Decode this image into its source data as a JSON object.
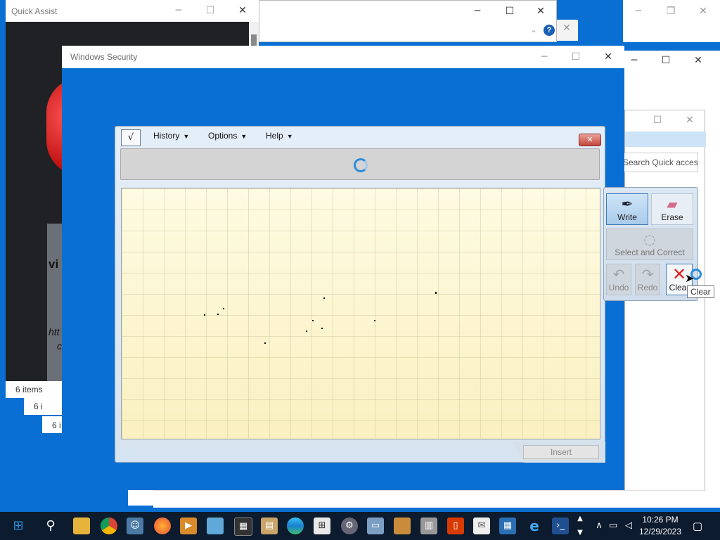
{
  "quick_assist": {
    "title": "Quick Assist",
    "partial_text_1": "vi",
    "partial_text_2": "htt",
    "partial_text_3": "c"
  },
  "explorer": {
    "status_1": "6 items",
    "status_2": "6 i",
    "status_3": "6 i",
    "search_placeholder": "Search Quick access"
  },
  "windows_security": {
    "title": "Windows Security"
  },
  "tip": {
    "menu": [
      "History",
      "Options",
      "Help"
    ],
    "close_label": "✕",
    "insert_label": "Insert"
  },
  "tools": {
    "write": "Write",
    "erase": "Erase",
    "select": "Select and Correct",
    "undo": "Undo",
    "redo": "Redo",
    "clear": "Clear",
    "tooltip": "Clear"
  },
  "taskbar": {
    "time": "10:26 PM",
    "date": "12/29/2023",
    "icons": [
      "start-icon",
      "search-icon",
      "file-explorer-icon",
      "chrome-icon",
      "people-icon",
      "firefox-icon",
      "media-icon",
      "image-viewer-icon",
      "calculator-icon",
      "calendar-icon",
      "edge-icon",
      "store-icon",
      "settings-gear-icon",
      "remote-desktop-icon",
      "utility-icon",
      "server-manager-icon",
      "office-icon",
      "mail-icon",
      "network-icon",
      "ie-icon",
      "powershell-icon"
    ]
  },
  "colors": {
    "desktop": "#0a6fd2",
    "taskbar": "#0c1b2e",
    "accent": "#2e8bd6"
  }
}
